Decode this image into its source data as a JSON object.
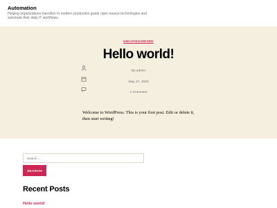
{
  "header": {
    "site_title": "Automation",
    "description": "Helping organizations transition to modern production grade open-source technologies and automate their daily IT workflows."
  },
  "post": {
    "category": "UNCATEGORIZED",
    "title": "Hello world!",
    "author": "By admin",
    "date": "May 17, 2020",
    "comments": "1 Comment",
    "content": "Welcome to WordPress. This is your first post. Edit or delete it, then start writing!"
  },
  "search": {
    "placeholder": "Search ...",
    "button_label": "SEARCH"
  },
  "recent_posts": {
    "heading": "Recent Posts",
    "items": [
      "Hello world!"
    ]
  },
  "colors": {
    "accent": "#cd2653",
    "post_background": "#f5efe0",
    "page_background": "#ffffff"
  }
}
